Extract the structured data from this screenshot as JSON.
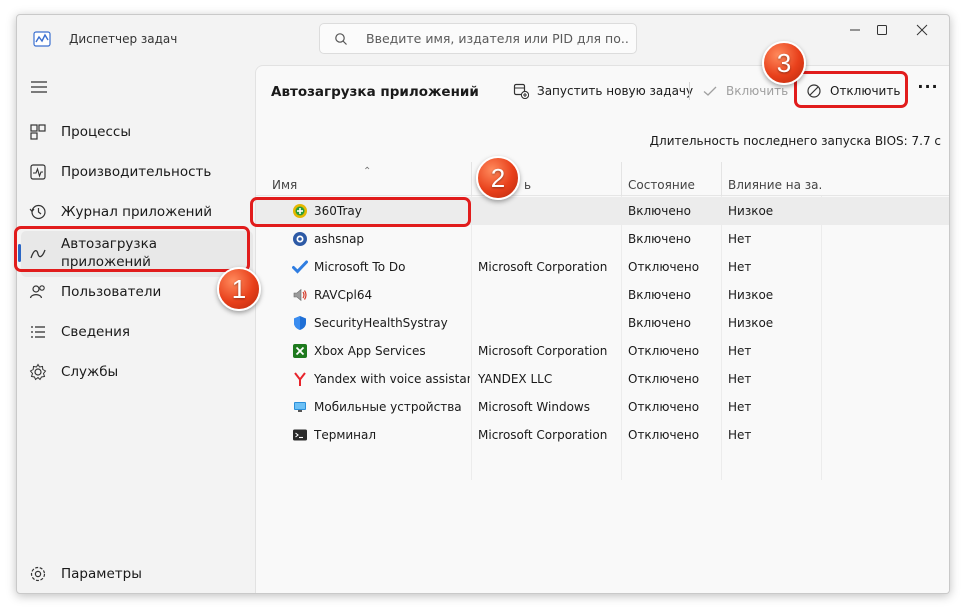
{
  "window": {
    "title": "Диспетчер задач",
    "search_placeholder": "Введите имя, издателя или PID для по..."
  },
  "sidebar": {
    "items": [
      {
        "label": "Процессы",
        "icon": "processes-icon"
      },
      {
        "label": "Производительность",
        "icon": "performance-icon"
      },
      {
        "label": "Журнал приложений",
        "icon": "history-icon"
      },
      {
        "label": "Автозагрузка приложений",
        "icon": "startup-icon",
        "active": true
      },
      {
        "label": "Пользователи",
        "icon": "users-icon"
      },
      {
        "label": "Сведения",
        "icon": "details-icon"
      },
      {
        "label": "Службы",
        "icon": "services-icon"
      }
    ],
    "settings_label": "Параметры"
  },
  "toolbar": {
    "title": "Автозагрузка приложений",
    "run_task_label": "Запустить новую задачу",
    "enable_label": "Включить",
    "disable_label": "Отключить",
    "more_label": "···"
  },
  "bios_text": "Длительность последнего запуска BIOS: 7.7 с",
  "table": {
    "columns": [
      "Имя",
      "ь",
      "Состояние",
      "Влияние на за..."
    ],
    "rows": [
      {
        "name": "360Tray",
        "publisher": "",
        "state": "Включено",
        "impact": "Низкое",
        "icon": "360tray-icon",
        "selected": true
      },
      {
        "name": "ashsnap",
        "publisher": "",
        "state": "Включено",
        "impact": "Нет",
        "icon": "ashsnap-icon"
      },
      {
        "name": "Microsoft To Do",
        "publisher": "Microsoft Corporation",
        "state": "Отключено",
        "impact": "Нет",
        "icon": "todo-check-icon"
      },
      {
        "name": "RAVCpl64",
        "publisher": "",
        "state": "Включено",
        "impact": "Низкое",
        "icon": "speaker-icon"
      },
      {
        "name": "SecurityHealthSystray",
        "publisher": "",
        "state": "Включено",
        "impact": "Низкое",
        "icon": "shield-icon"
      },
      {
        "name": "Xbox App Services",
        "publisher": "Microsoft Corporation",
        "state": "Отключено",
        "impact": "Нет",
        "icon": "xbox-icon"
      },
      {
        "name": "Yandex with voice assistan...",
        "publisher": "YANDEX LLC",
        "state": "Отключено",
        "impact": "Нет",
        "icon": "yandex-icon"
      },
      {
        "name": "Мобильные устройства",
        "publisher": "Microsoft Windows",
        "state": "Отключено",
        "impact": "Нет",
        "icon": "mobile-devices-icon"
      },
      {
        "name": "Терминал",
        "publisher": "Microsoft Corporation",
        "state": "Отключено",
        "impact": "Нет",
        "icon": "terminal-icon"
      }
    ]
  },
  "annotations": {
    "step1": "1",
    "step2": "2",
    "step3": "3",
    "color": "#e11c1c"
  }
}
